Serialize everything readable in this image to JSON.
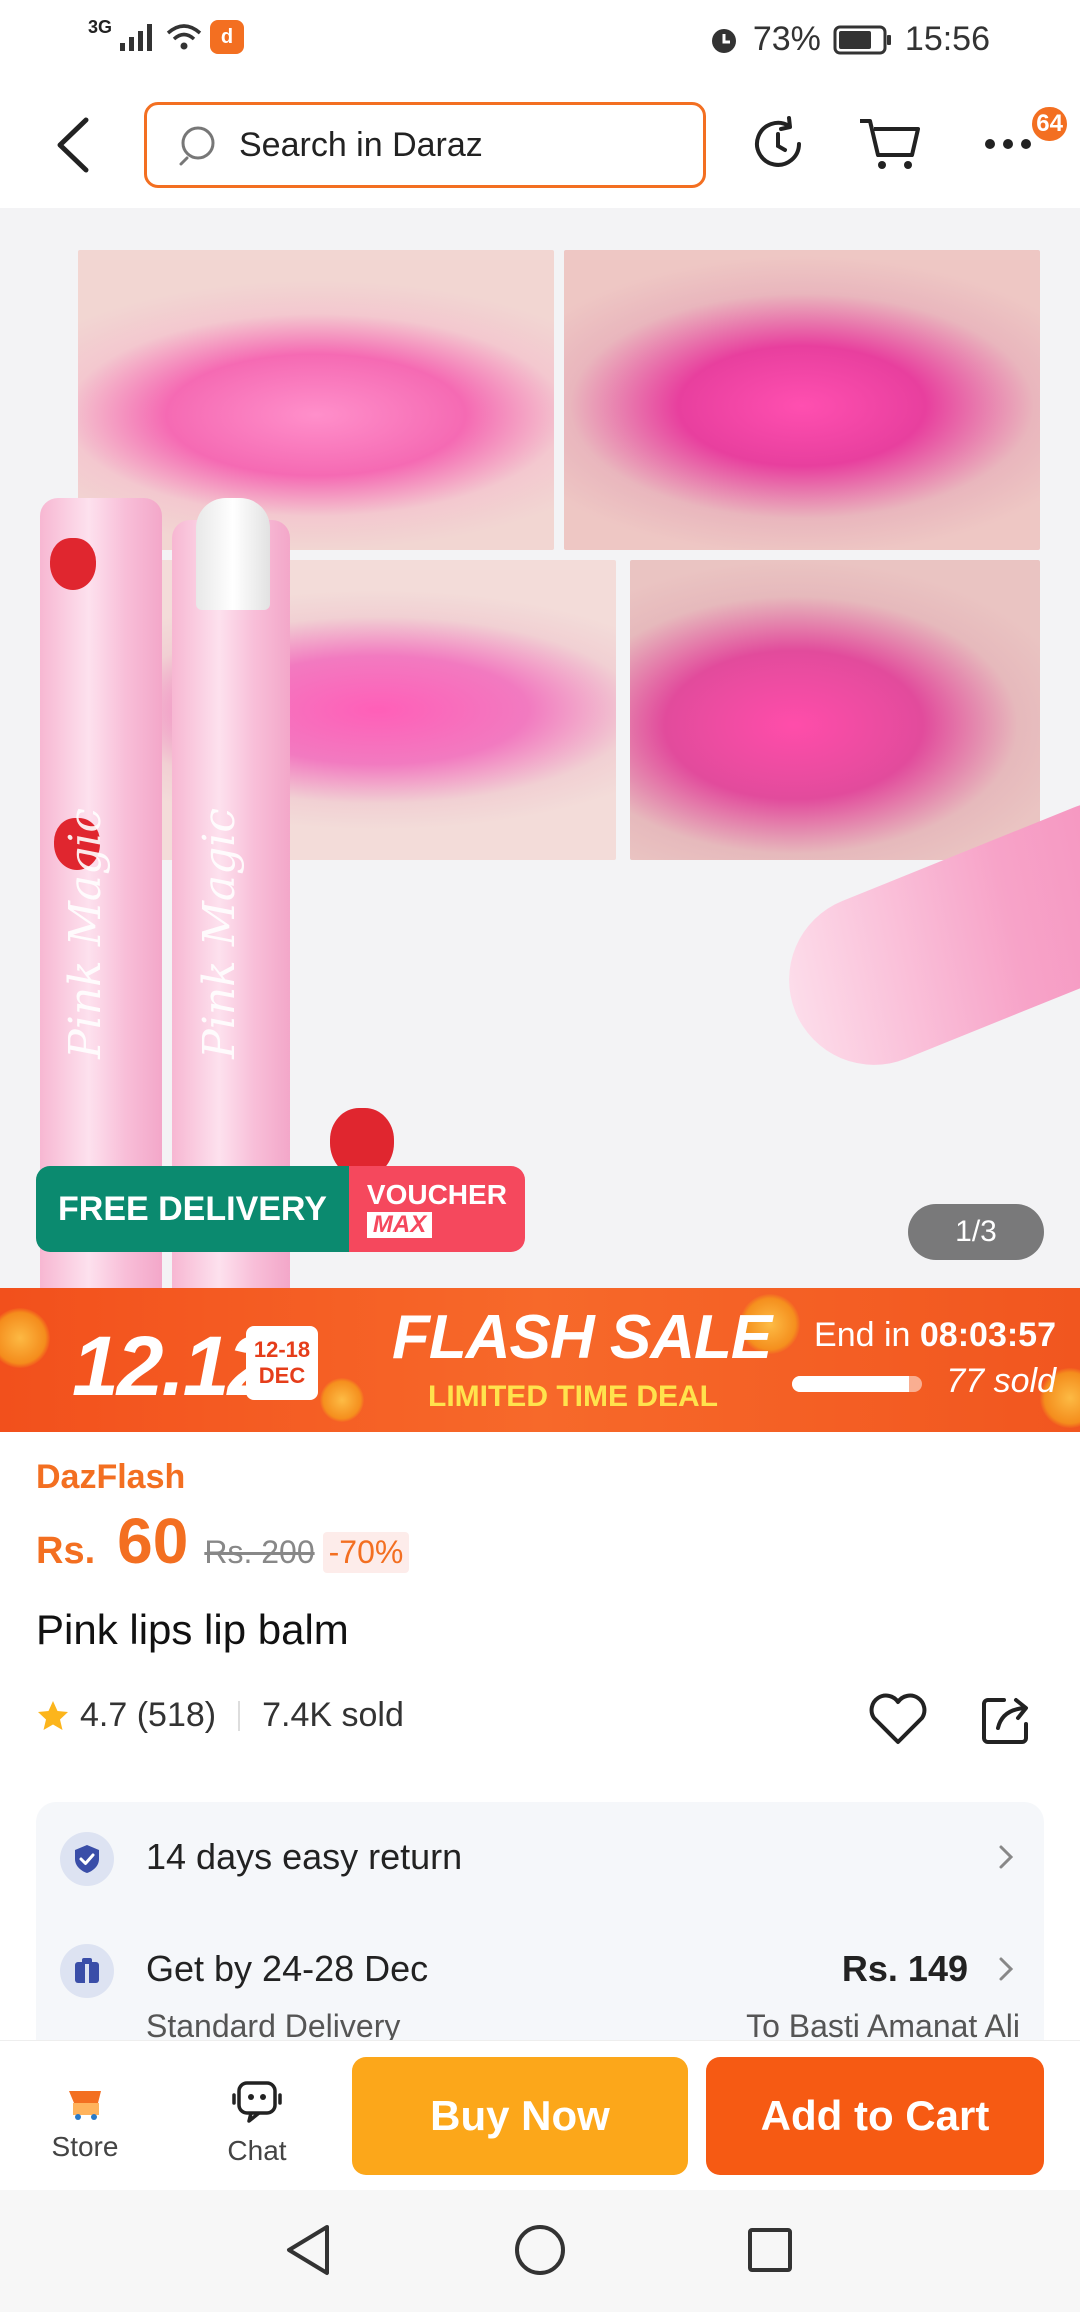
{
  "status_bar": {
    "network": "3G",
    "battery": "73%",
    "time": "15:56"
  },
  "header": {
    "search_placeholder": "Search in Daraz",
    "more_badge": "64",
    "icons": [
      "back-arrow-icon",
      "search-icon",
      "history-icon",
      "cart-icon",
      "more-icon"
    ]
  },
  "gallery": {
    "badge_free_delivery": "FREE DELIVERY",
    "badge_voucher": "VOUCHER",
    "badge_voucher_max": "MAX",
    "image_counter": "1/3"
  },
  "flash_sale": {
    "date": "12.12",
    "range_days": "12-18",
    "range_month": "DEC",
    "title": "FLASH SALE",
    "subtitle": "LIMITED TIME DEAL",
    "end_label": "End in",
    "end_time": "08:03:57",
    "sold": "77 sold",
    "progress": 0.9
  },
  "product": {
    "brand_tag": "DazFlash",
    "currency": "Rs.",
    "price": "60",
    "old_price": "Rs. 200",
    "discount": "-70%",
    "title": "Pink lips lip balm",
    "rating": "4.7 (518)",
    "sold": "7.4K sold"
  },
  "info": {
    "return_text": "14 days easy return",
    "delivery_text": "Get by 24-28 Dec",
    "delivery_price": "Rs. 149",
    "delivery_type": "Standard Delivery",
    "delivery_to": "To Basti Amanat Ali"
  },
  "action_bar": {
    "store_label": "Store",
    "chat_label": "Chat",
    "buy_now_label": "Buy Now",
    "add_to_cart_label": "Add to Cart"
  },
  "colors": {
    "brand_orange": "#f36f21",
    "buy_now": "#fca71a",
    "add_to_cart": "#f65a13",
    "free_delivery": "#0b8a6f",
    "voucher": "#f5485d"
  }
}
